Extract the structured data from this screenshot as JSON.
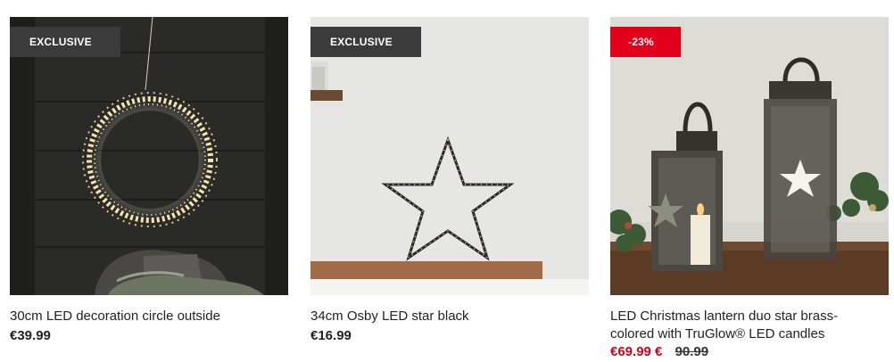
{
  "products": [
    {
      "badge": "EXCLUSIVE",
      "image_alt": "LED decoration circle",
      "title": "30cm LED decoration circle outside",
      "price": "€39.99"
    },
    {
      "badge": "EXCLUSIVE",
      "image_alt": "LED star black",
      "title": "34cm Osby LED star black",
      "price": "€16.99"
    },
    {
      "badge": "-23%",
      "image_alt": "LED Christmas lantern duo",
      "title_line1": "LED Christmas lantern duo star brass-",
      "title_line2": "colored with TruGlow® LED candles",
      "price": "€69.99 €",
      "old_price": "90.99"
    }
  ],
  "colors": {
    "badge_dark": "#3b3b3b",
    "badge_sale": "#e3001b",
    "sale_price": "#d5001c"
  }
}
